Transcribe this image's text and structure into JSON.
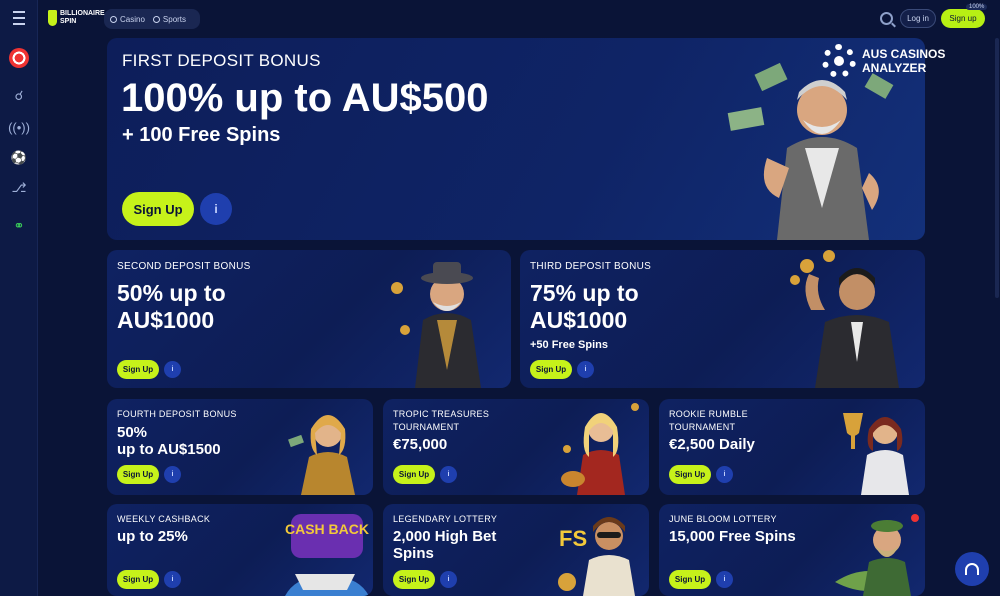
{
  "brand": {
    "logo_text": "BILLIONAIRE SPIN",
    "accent": "#c6f21a"
  },
  "topbar": {
    "nav": [
      {
        "label": "Casino",
        "icon": "casino-icon"
      },
      {
        "label": "Sports",
        "icon": "sports-ball-icon"
      }
    ],
    "login_label": "Log in",
    "signup_label": "Sign up",
    "signup_badge": "100%"
  },
  "sidebar": {
    "icons": [
      "menu-icon",
      "target-icon",
      "cherries-icon",
      "live-icon",
      "soccer-icon",
      "gamepad-icon",
      "support-icon"
    ]
  },
  "watermark": {
    "line1": "AUS CASINOS",
    "line2": "ANALYZER"
  },
  "hero": {
    "eyebrow": "FIRST DEPOSIT BONUS",
    "headline": "100% up to AU$500",
    "sub": "+ 100 Free Spins",
    "button": "Sign Up",
    "info": "i"
  },
  "cards": [
    {
      "eyebrow": "SECOND DEPOSIT BONUS",
      "line1": "50% up to",
      "line2": "AU$1000",
      "sub": "",
      "button": "Sign Up",
      "info": "i"
    },
    {
      "eyebrow": "THIRD DEPOSIT BONUS",
      "line1": "75% up to",
      "line2": "AU$1000",
      "sub": "+50 Free Spins",
      "button": "Sign Up",
      "info": "i"
    },
    {
      "eyebrow": "FOURTH DEPOSIT BONUS",
      "line1": "50%",
      "line2": "up to AU$1500",
      "button": "Sign Up",
      "info": "i"
    },
    {
      "eyebrow": "TROPIC TREASURES",
      "eyebrow2": "TOURNAMENT",
      "line1": "€75,000",
      "button": "Sign Up",
      "info": "i"
    },
    {
      "eyebrow": "ROOKIE RUMBLE",
      "eyebrow2": "TOURNAMENT",
      "line1": "€2,500 Daily",
      "button": "Sign Up",
      "info": "i"
    },
    {
      "eyebrow": "WEEKLY CASHBACK",
      "line1": "up to 25%",
      "button": "Sign Up",
      "info": "i"
    },
    {
      "eyebrow": "LEGENDARY LOTTERY",
      "line1": "2,000 High Bet",
      "line2": "Spins",
      "button": "Sign Up",
      "info": "i"
    },
    {
      "eyebrow": "JUNE BLOOM LOTTERY",
      "line1": "15,000 Free Spins",
      "button": "Sign Up",
      "info": "i"
    }
  ],
  "promo_art": {
    "cashback_text": "CASH BACK",
    "fs_text": "FS"
  }
}
